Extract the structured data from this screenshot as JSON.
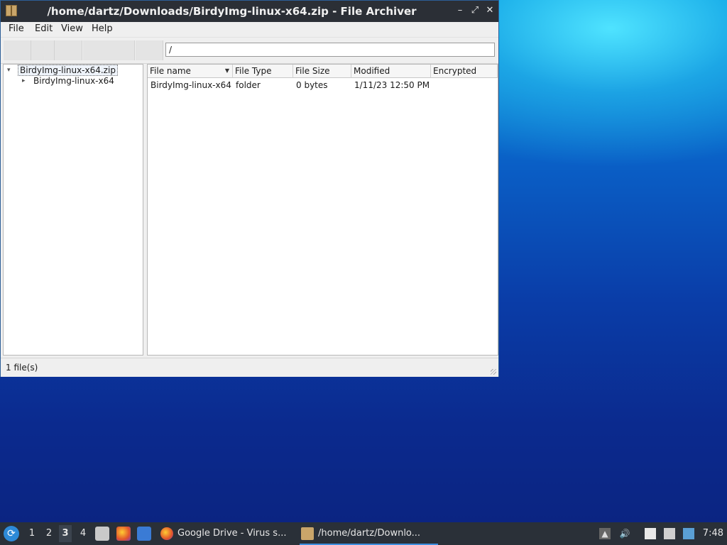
{
  "window": {
    "title": "/home/dartz/Downloads/BirdyImg-linux-x64.zip - File Archiver",
    "controls": {
      "minimize": "–",
      "maximize": "⤢",
      "close": "✕"
    }
  },
  "menu": [
    "File",
    "Edit",
    "View",
    "Help"
  ],
  "location": {
    "value": "/"
  },
  "tree": {
    "root": "BirdyImg-linux-x64.zip",
    "child": "BirdyImg-linux-x64",
    "expanded_glyph": "▾",
    "collapsed_glyph": "▸"
  },
  "columns": [
    "File name",
    "File Type",
    "File Size",
    "Modified",
    "Encrypted"
  ],
  "rows": [
    [
      "BirdyImg-linux-x64",
      "folder",
      "0 bytes",
      "1/11/23 12:50 PM",
      ""
    ]
  ],
  "status": "1 file(s)",
  "taskbar": {
    "workspaces": [
      "1",
      "2",
      "3",
      "4"
    ],
    "tasks": [
      {
        "label": "Google Drive - Virus s..."
      },
      {
        "label": "/home/dartz/Downlo..."
      }
    ],
    "clock": "7:48"
  },
  "colors": {
    "titlebar": "#2b2f36",
    "accent": "#3d8fe0"
  }
}
